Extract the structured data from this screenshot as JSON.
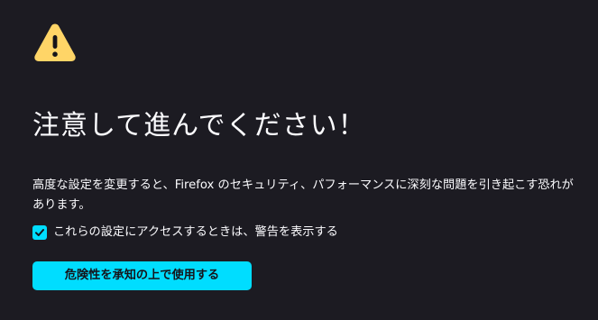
{
  "title": "注意して進んでください！",
  "description": "高度な設定を変更すると、Firefox のセキュリティ、パフォーマンスに深刻な問題を引き起こす恐れがあります。",
  "checkbox": {
    "label": "これらの設定にアクセスするときは、警告を表示する",
    "checked": true
  },
  "accept_button": {
    "label": "危険性を承知の上で使用する"
  },
  "icons": {
    "warning": "warning-triangle-icon",
    "check": "checkmark-icon"
  },
  "colors": {
    "background": "#1c1b22",
    "text": "#fbfbfe",
    "accent": "#00ddff",
    "warning": "#ffd567",
    "button_text": "#15141a"
  }
}
